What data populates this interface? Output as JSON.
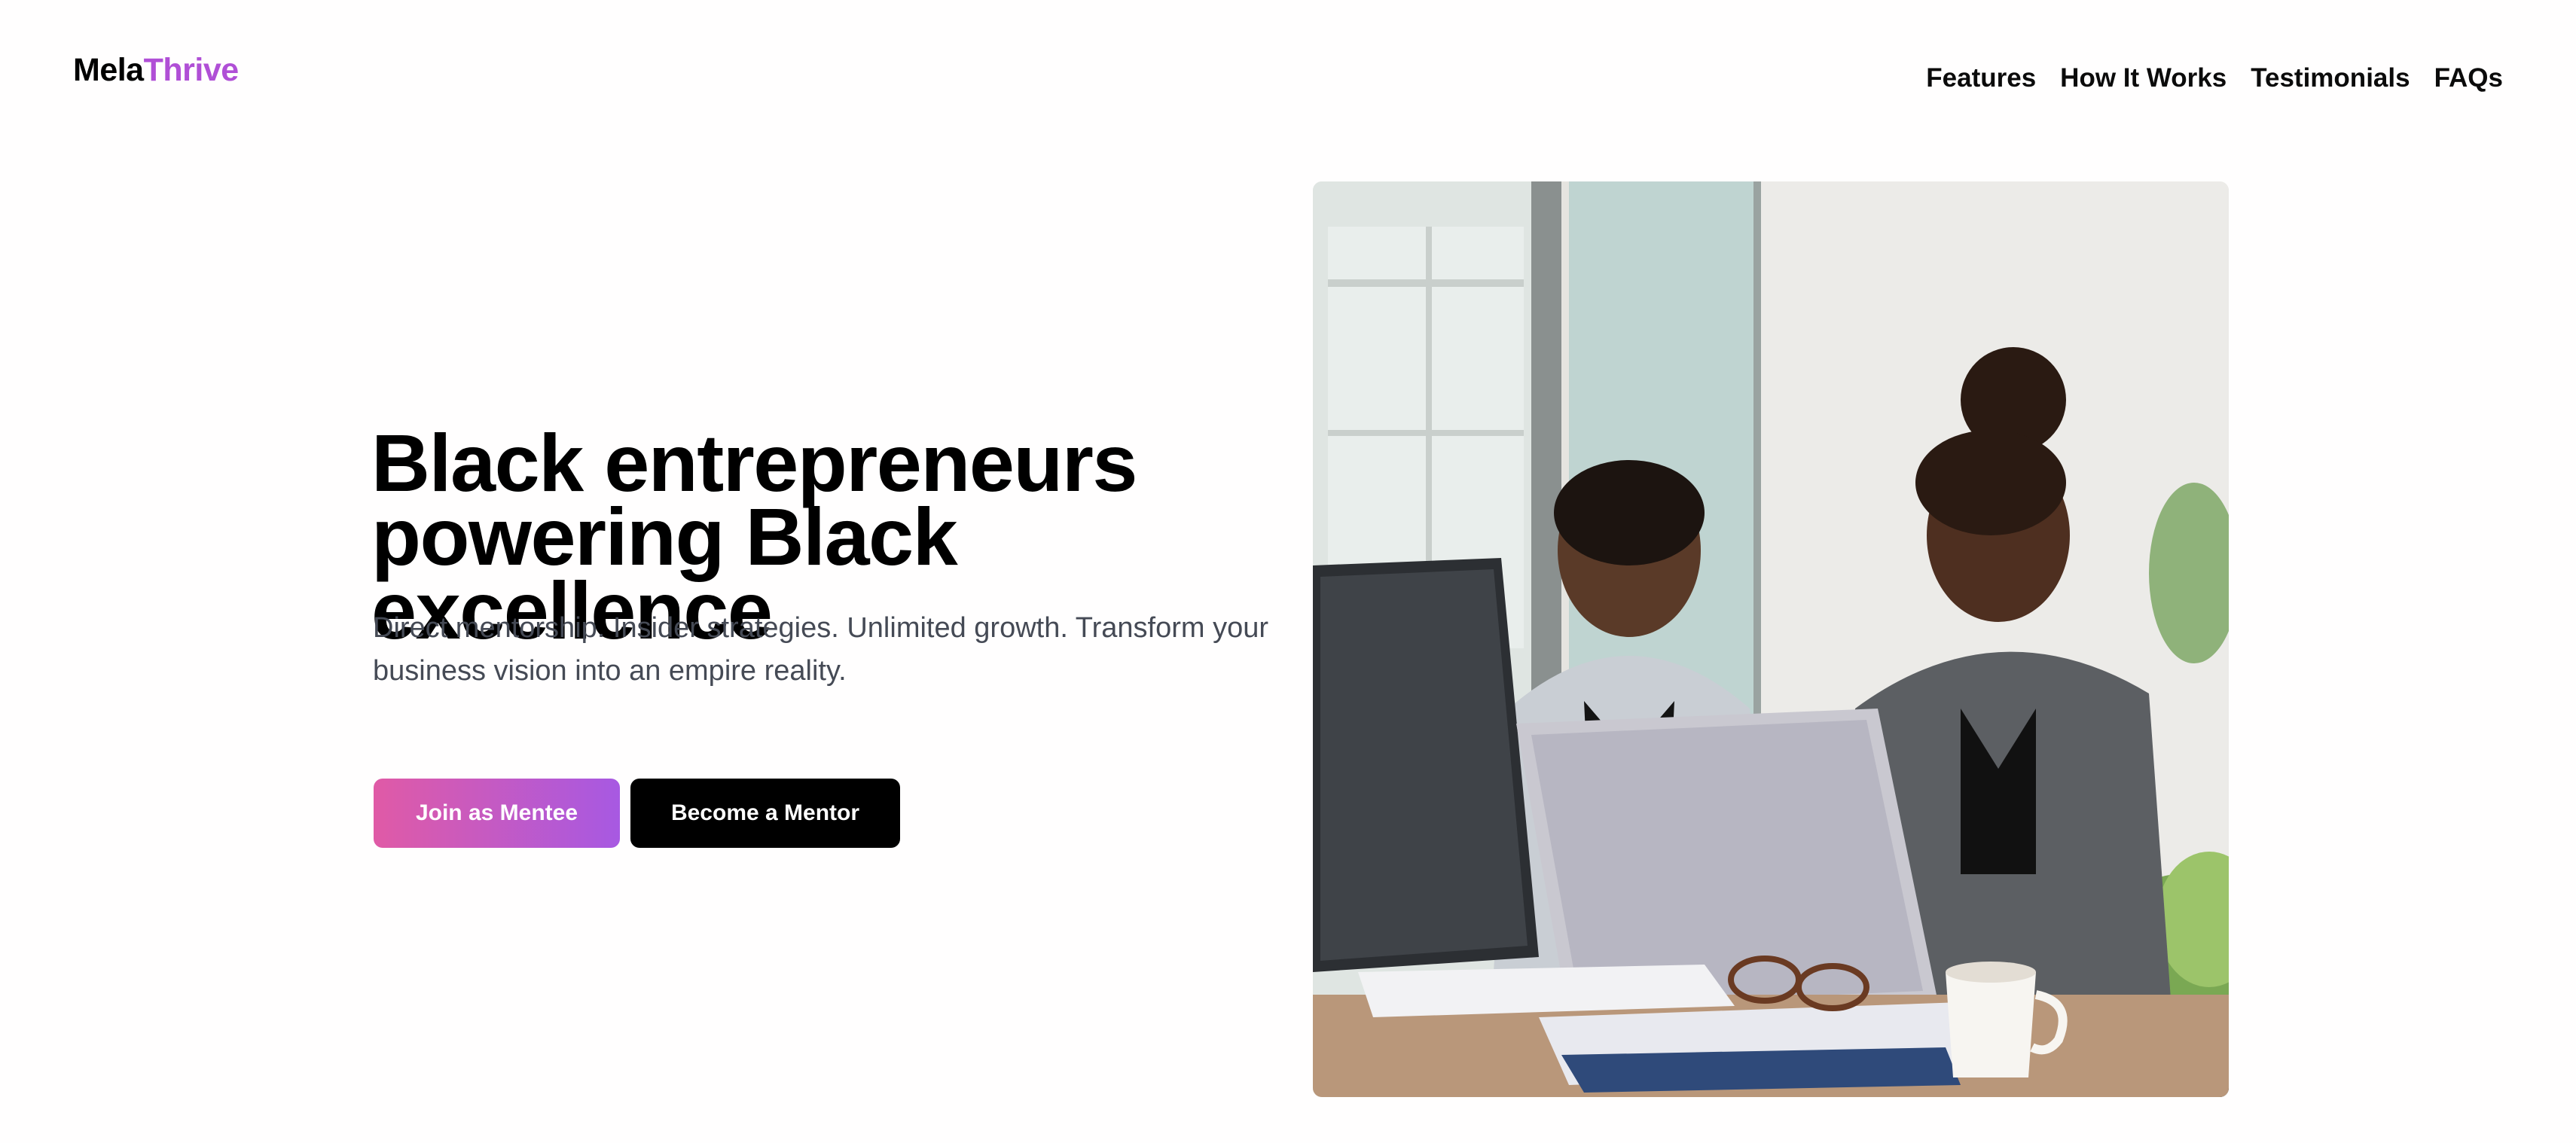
{
  "brand": {
    "logo_part1": "Mela",
    "logo_part2": "Thrive",
    "accent_color": "#b04fd6"
  },
  "nav": {
    "items": [
      {
        "label": "Features"
      },
      {
        "label": "How It Works"
      },
      {
        "label": "Testimonials"
      },
      {
        "label": "FAQs"
      }
    ]
  },
  "hero": {
    "title_line1": "Black entrepreneurs",
    "title_line2": "powering Black excellence",
    "subtitle": "Direct mentorship. Insider strategies. Unlimited growth. Transform your business vision into an empire reality.",
    "primary_button": "Join as Mentee",
    "secondary_button": "Become a Mentor",
    "primary_gradient": [
      "#e05aa6",
      "#a759e2"
    ],
    "secondary_color": "#000000"
  },
  "image": {
    "icon": "hero-photo-two-women-working-at-laptop"
  }
}
